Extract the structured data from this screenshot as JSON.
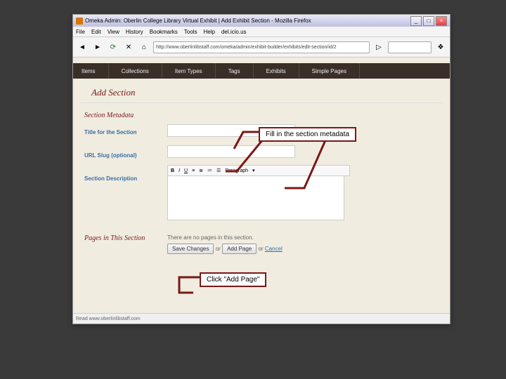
{
  "window": {
    "title": "Omeka Admin: Oberlin College Library Virtual Exhibit | Add Exhibit Section - Mozilla Firefox",
    "min": "_",
    "max": "□",
    "close": "×"
  },
  "menu": {
    "file": "File",
    "edit": "Edit",
    "view": "View",
    "history": "History",
    "bookmarks": "Bookmarks",
    "tools": "Tools",
    "help": "Help",
    "delicious": "del.icio.us"
  },
  "url": "http://www.oberlinlibstaff.com/omeka/admin/exhibit-builder/exhibits/edit-section/id/2",
  "nav": {
    "items": "Items",
    "collections": "Collections",
    "itemtypes": "Item Types",
    "tags": "Tags",
    "exhibits": "Exhibits",
    "simplepages": "Simple Pages"
  },
  "page": {
    "heading": "Add Section",
    "section_meta": "Section Metadata",
    "title_lbl": "Title for the Section",
    "slug_lbl": "URL Slug (optional)",
    "desc_lbl": "Section Description",
    "paragraph": "Paragraph"
  },
  "pages": {
    "heading": "Pages in This Section",
    "note": "There are no pages in this section.",
    "save": "Save Changes",
    "or1": "or",
    "addpage": "Add Page",
    "or2": "or",
    "cancel": "Cancel"
  },
  "status": "Read www.oberlinlibstaff.com",
  "callouts": {
    "c1": "Fill in the section metadata",
    "c2": "Click \"Add Page\""
  }
}
